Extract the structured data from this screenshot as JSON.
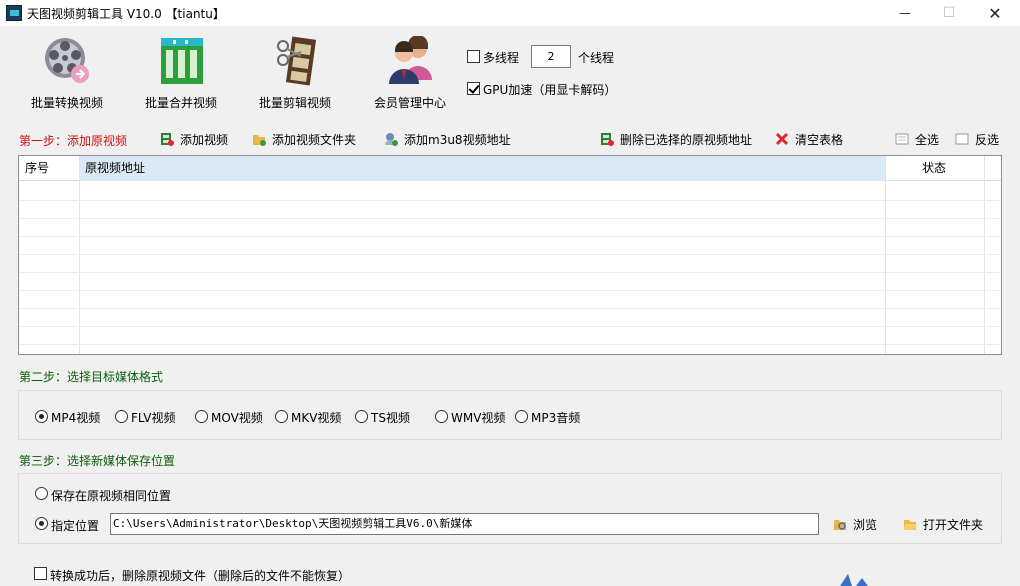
{
  "window": {
    "title": "天图视频剪辑工具 V10.0  【tiantu】",
    "minimize": "—",
    "maximize": "☐",
    "close": "✕"
  },
  "toolbar": {
    "batch_convert": "批量转换视频",
    "batch_merge": "批量合并视频",
    "batch_cut": "批量剪辑视频",
    "member_center": "会员管理中心"
  },
  "options": {
    "multithread_label": "多线程",
    "multithread_checked": false,
    "thread_count": "2",
    "thread_suffix": "个线程",
    "gpu_label": "GPU加速（用显卡解码）",
    "gpu_checked": true
  },
  "step1": {
    "title": "第一步：添加原视频",
    "add_video": "添加视频",
    "add_folder": "添加视频文件夹",
    "add_m3u8": "添加m3u8视频地址",
    "delete_selected": "删除已选择的原视频地址",
    "clear_table": "清空表格",
    "select_all": "全选",
    "invert_select": "反选"
  },
  "table": {
    "columns": [
      "序号",
      "原视频地址",
      "状态"
    ],
    "rows": []
  },
  "step2": {
    "title": "第二步：选择目标媒体格式",
    "formats": [
      "MP4视频",
      "FLV视频",
      "MOV视频",
      "MKV视频",
      "TS视频",
      "WMV视频",
      "MP3音频"
    ],
    "selected": "MP4视频"
  },
  "step3": {
    "title": "第三步：选择新媒体保存位置",
    "same_location": "保存在原视频相同位置",
    "custom_location": "指定位置",
    "selected": "指定位置",
    "path": "C:\\Users\\Administrator\\Desktop\\天图视频剪辑工具V6.0\\新媒体",
    "browse": "浏览",
    "open_folder": "打开文件夹"
  },
  "footer": {
    "delete_after_label": "转换成功后，删除原视频文件（删除后的文件不能恢复）",
    "delete_after_checked": false
  },
  "colors": {
    "step1": "#d01010",
    "step_other": "#0a5c0a",
    "selected_header": "#d9e9f7"
  }
}
